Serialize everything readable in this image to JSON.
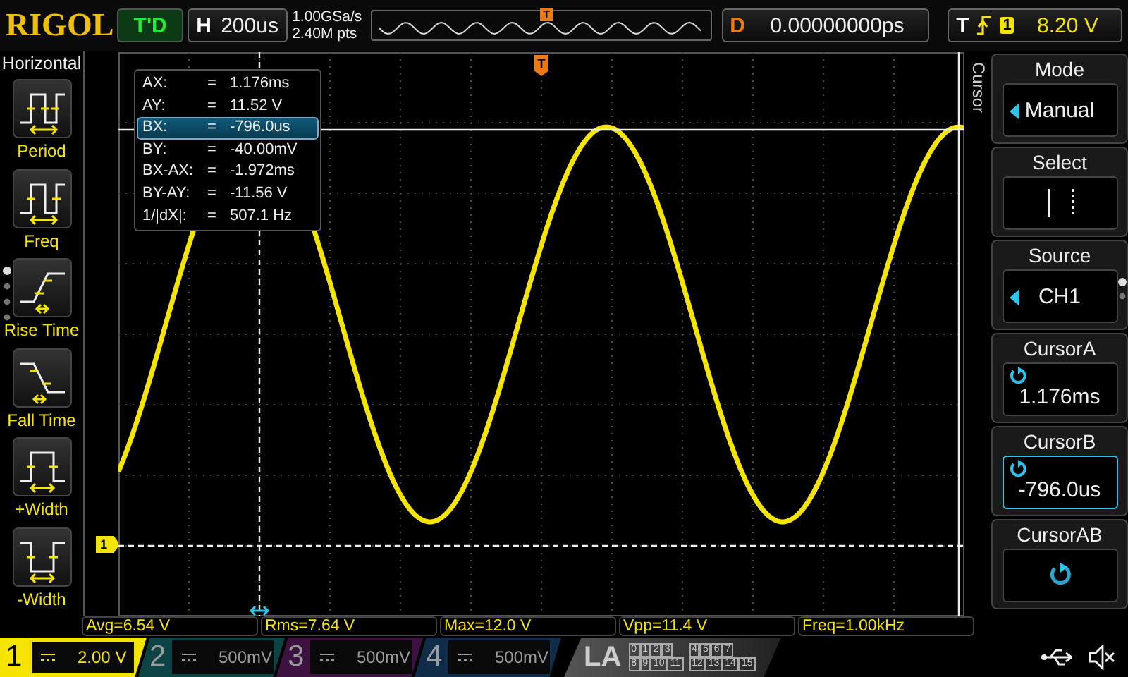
{
  "top_bar": {
    "logo": "RIGOL",
    "run_status": "T'D",
    "timebase": {
      "label": "H",
      "value": "200us"
    },
    "sample_rate": "1.00GSa/s",
    "memory_depth": "2.40M pts",
    "memory_trigger_marker": "T",
    "delay": {
      "label": "D",
      "value": "0.00000000ps"
    },
    "trigger": {
      "label": "T",
      "source": "1",
      "level": "8.20 V"
    }
  },
  "left_menu": {
    "title": "Horizontal",
    "items": [
      {
        "kind": "period",
        "label": "Period"
      },
      {
        "kind": "freq",
        "label": "Freq"
      },
      {
        "kind": "rise",
        "label": "Rise Time"
      },
      {
        "kind": "fall",
        "label": "Fall Time"
      },
      {
        "kind": "pwidth",
        "label": "+Width"
      },
      {
        "kind": "nwidth",
        "label": "-Width"
      }
    ]
  },
  "scope": {
    "trigger_marker": "T",
    "channel_marker": "1",
    "cursor_readout": [
      {
        "label": "AX:",
        "eq": "=",
        "value": "1.176ms",
        "selected": false
      },
      {
        "label": "AY:",
        "eq": "=",
        "value": "11.52 V",
        "selected": false
      },
      {
        "label": "BX:",
        "eq": "=",
        "value": "-796.0us",
        "selected": true
      },
      {
        "label": "BY:",
        "eq": "=",
        "value": "-40.00mV",
        "selected": false
      },
      {
        "label": "BX-AX:",
        "eq": "=",
        "value": "-1.972ms",
        "selected": false
      },
      {
        "label": "BY-AY:",
        "eq": "=",
        "value": "-11.56 V",
        "selected": false
      },
      {
        "label": "1/|dX|:",
        "eq": "=",
        "value": "507.1 Hz",
        "selected": false
      }
    ]
  },
  "side_label": "Cursor",
  "right_menu": [
    {
      "kind": "dropdown",
      "title": "Mode",
      "value": "Manual",
      "selected": false
    },
    {
      "kind": "select",
      "title": "Select",
      "selected": false
    },
    {
      "kind": "dropdown",
      "title": "Source",
      "value": "CH1",
      "selected": false
    },
    {
      "kind": "knob",
      "title": "CursorA",
      "value": "1.176ms",
      "selected": false
    },
    {
      "kind": "knob",
      "title": "CursorB",
      "value": "-796.0us",
      "selected": true
    },
    {
      "kind": "knob",
      "title": "CursorAB",
      "selected": false
    }
  ],
  "measurements": [
    "Avg=6.54 V",
    "Rms=7.64 V",
    "Max=12.0 V",
    "Vpp=11.4 V",
    "Freq=1.00kHz"
  ],
  "channels": [
    {
      "number": "1",
      "scale": "2.00 V",
      "selected": true,
      "color": "#f5e400"
    },
    {
      "number": "2",
      "scale": "500mV",
      "selected": false,
      "color": "#0c4446"
    },
    {
      "number": "3",
      "scale": "500mV",
      "selected": false,
      "color": "#3e1240"
    },
    {
      "number": "4",
      "scale": "500mV",
      "selected": false,
      "color": "#102c48"
    }
  ],
  "la": {
    "label": "LA",
    "bits": [
      [
        "0",
        "1",
        "2",
        "3"
      ],
      [
        "4",
        "5",
        "6",
        "7"
      ],
      [
        "8",
        "9",
        "10",
        "11"
      ],
      [
        "12",
        "13",
        "14",
        "15"
      ]
    ]
  }
}
